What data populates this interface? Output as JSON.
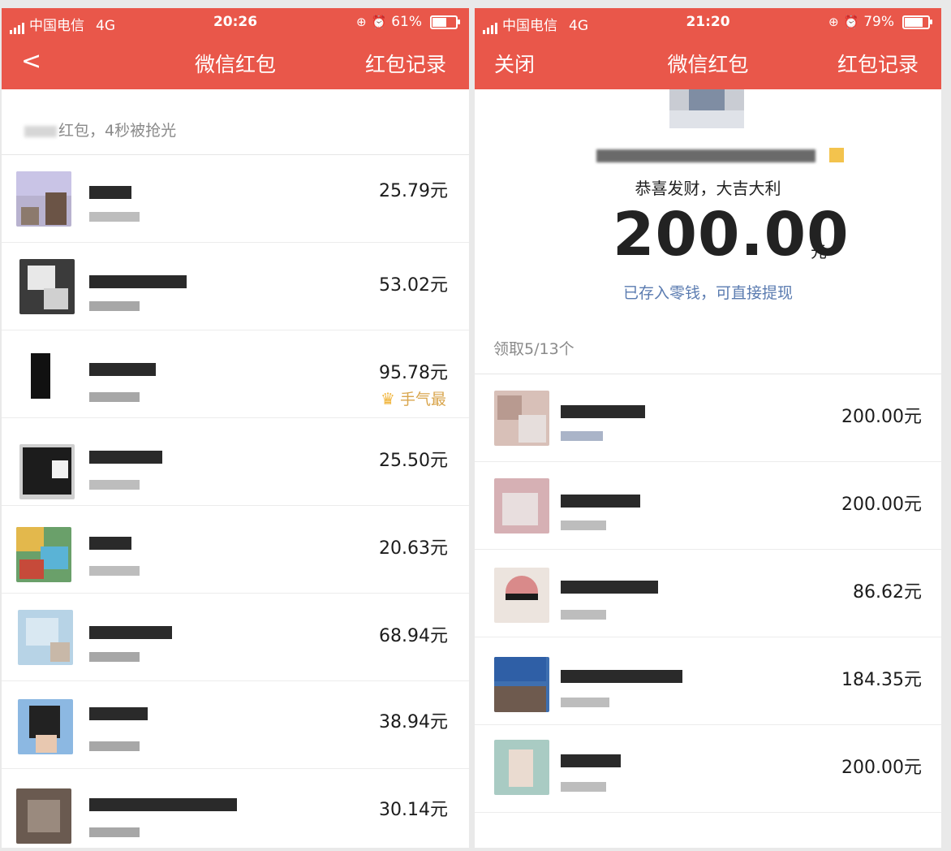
{
  "left": {
    "status": {
      "carrier": "中国电信",
      "network": "4G",
      "time": "20:26",
      "battery": "61%",
      "battery_level": 0.61
    },
    "nav": {
      "back_icon": "chevron-left-icon",
      "title": "微信红包",
      "records": "红包记录"
    },
    "summary": "红包，4秒被抢光",
    "items": [
      {
        "amount": "25.79元"
      },
      {
        "amount": "53.02元"
      },
      {
        "amount": "95.78元",
        "lucky": "手气最"
      },
      {
        "amount": "25.50元"
      },
      {
        "amount": "20.63元"
      },
      {
        "amount": "68.94元"
      },
      {
        "amount": "38.94元"
      },
      {
        "amount": "30.14元"
      }
    ]
  },
  "right": {
    "status": {
      "carrier": "中国电信",
      "network": "4G",
      "time": "21:20",
      "battery": "79%",
      "battery_level": 0.79
    },
    "nav": {
      "close": "关闭",
      "title": "微信红包",
      "records": "红包记录"
    },
    "blessing": "恭喜发财，大吉大利",
    "amount": "200.00",
    "unit": "元",
    "note": "已存入零钱，可直接提现",
    "received": "领取5/13个",
    "items": [
      {
        "amount": "200.00元"
      },
      {
        "amount": "200.00元"
      },
      {
        "amount": "86.62元"
      },
      {
        "amount": "184.35元"
      },
      {
        "amount": "200.00元"
      }
    ]
  },
  "colors": {
    "header": "#e9574a",
    "link": "#5a7bb0",
    "lucky": "#d9a64e"
  }
}
